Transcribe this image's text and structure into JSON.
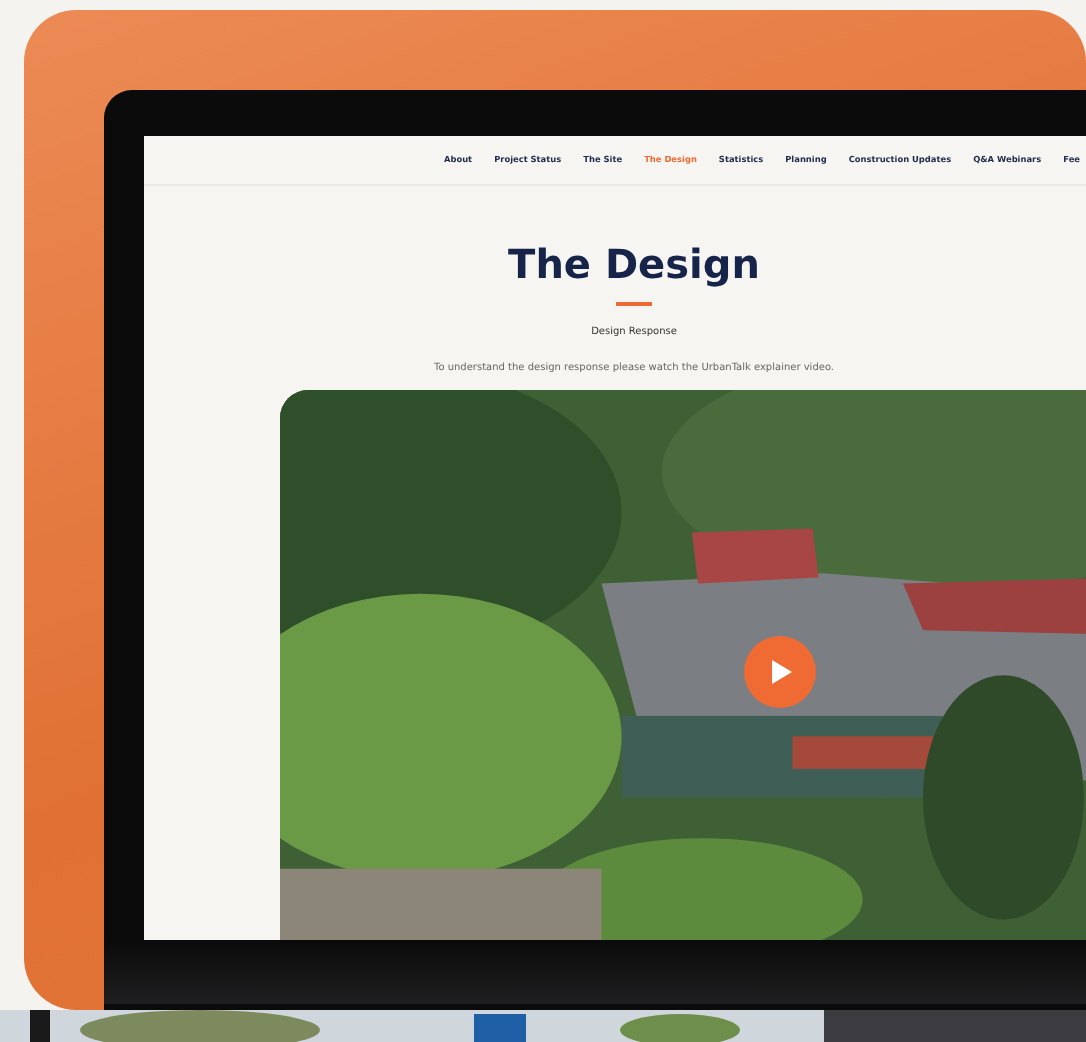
{
  "nav": {
    "items": [
      {
        "label": "About",
        "selected": false
      },
      {
        "label": "Project Status",
        "selected": false
      },
      {
        "label": "The Site",
        "selected": false
      },
      {
        "label": "The Design",
        "selected": true
      },
      {
        "label": "Statistics",
        "selected": false
      },
      {
        "label": "Planning",
        "selected": false
      },
      {
        "label": "Construction Updates",
        "selected": false
      },
      {
        "label": "Q&A Webinars",
        "selected": false
      },
      {
        "label": "Fee",
        "selected": false
      }
    ]
  },
  "page": {
    "title": "The Design",
    "subtitle": "Design Response",
    "intro": "To understand the design response please watch the UrbanTalk explainer video."
  }
}
